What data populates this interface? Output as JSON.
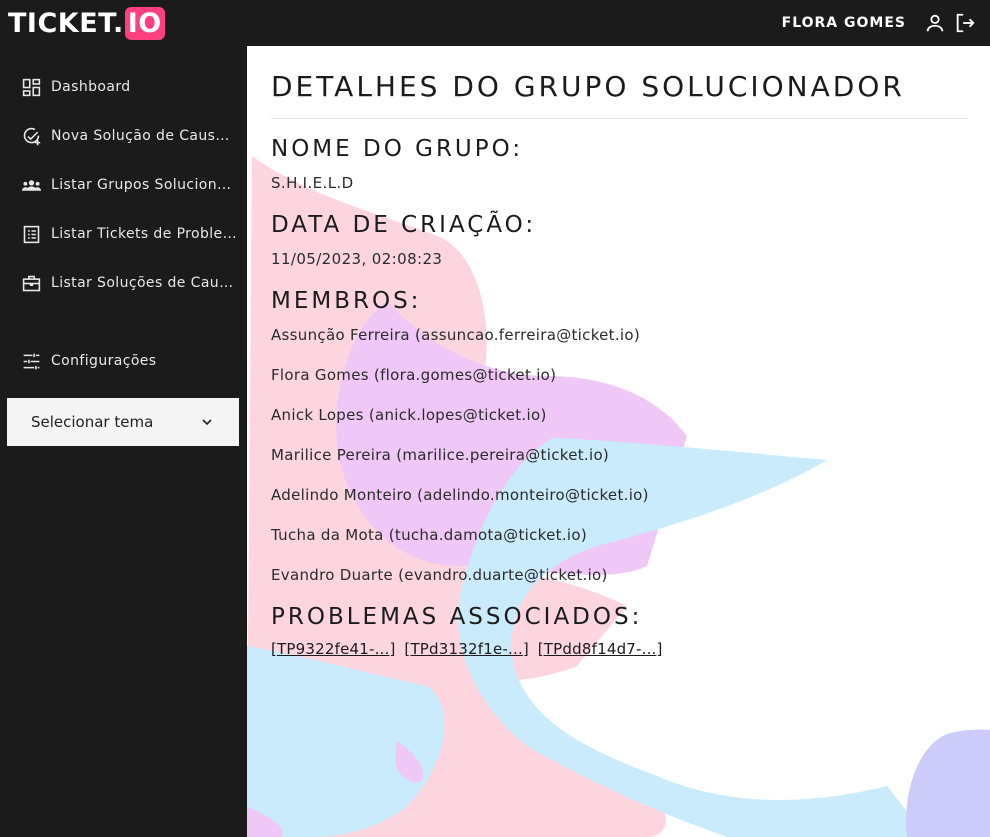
{
  "header": {
    "logo_main": "TICKET.",
    "logo_accent": "IO",
    "user_name": "FLORA GOMES",
    "user_icon": "person-icon",
    "logout_icon": "logout-icon",
    "accent_color": "#ff3f7f"
  },
  "sidebar": {
    "items": [
      {
        "label": "Dashboard",
        "icon": "dashboard-icon"
      },
      {
        "label": "Nova Solução de Causa Raiz",
        "icon": "add-check-icon"
      },
      {
        "label": "Listar Grupos Solucionadores",
        "icon": "groups-icon"
      },
      {
        "label": "Listar Tickets de Problema",
        "icon": "list-icon"
      },
      {
        "label": "Listar Soluções de Causa Raiz",
        "icon": "briefcase-icon"
      }
    ],
    "settings": {
      "label": "Configurações",
      "icon": "sliders-icon"
    },
    "theme_select": {
      "label": "Selecionar tema",
      "icon": "chevron-down-icon"
    }
  },
  "main": {
    "title": "DETALHES DO GRUPO SOLUCIONADOR",
    "group_name_label": "NOME DO GRUPO:",
    "group_name": "S.H.I.E.L.D",
    "created_label": "DATA DE CRIAÇÃO:",
    "created_at": "11/05/2023, 02:08:23",
    "members_label": "MEMBROS:",
    "members": [
      "Assunção Ferreira (assuncao.ferreira@ticket.io)",
      "Flora Gomes (flora.gomes@ticket.io)",
      "Anick Lopes (anick.lopes@ticket.io)",
      "Marilice Pereira (marilice.pereira@ticket.io)",
      "Adelindo Monteiro (adelindo.monteiro@ticket.io)",
      "Tucha da Mota (tucha.damota@ticket.io)",
      "Evandro Duarte (evandro.duarte@ticket.io)"
    ],
    "problems_label": "PROBLEMAS ASSOCIADOS:",
    "problems": [
      "[TP9322fe41-...]",
      "[TPd3132f1e-...]",
      "[TPdd8f14d7-...]"
    ]
  },
  "colors": {
    "sidebar_bg": "#1b1b1b",
    "blob_pink": "#fdd5df",
    "blob_blue": "#c9ebfb",
    "blob_violet": "#f0c8f7",
    "blob_lavender": "#cccbfa"
  }
}
